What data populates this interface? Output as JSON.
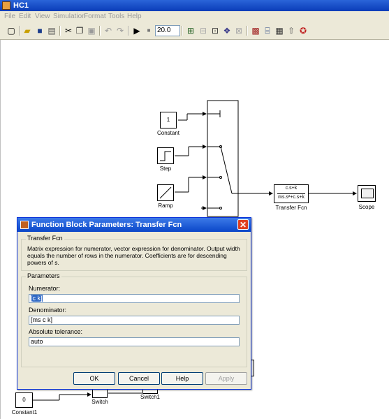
{
  "window": {
    "title": "HC1"
  },
  "menu": [
    "File",
    "Edit",
    "View",
    "Simulation",
    "Format",
    "Tools",
    "Help"
  ],
  "toolbar": {
    "sim_time": "20.0",
    "icons": [
      "new-icon",
      "open-icon",
      "save-icon",
      "print-icon",
      "cut-icon",
      "copy-icon",
      "paste-icon",
      "undo-icon",
      "redo-icon",
      "play-icon",
      "stop-icon",
      "build-icon",
      "update-icon",
      "library-icon",
      "explorer-icon",
      "debug-icon",
      "model-advisor-icon",
      "up-icon",
      "help-icon"
    ]
  },
  "diagram": {
    "blocks": {
      "constant": {
        "value": "1",
        "label": "Constant"
      },
      "step": {
        "label": "Step"
      },
      "ramp": {
        "label": "Ramp"
      },
      "transfer_fcn": {
        "num": "c.s+k",
        "den": "ms.s²+c.s+k",
        "label": "Transfer Fcn"
      },
      "scope": {
        "label": "Scope"
      },
      "constant1": {
        "value": "0",
        "label": "Constant1"
      },
      "switch": {
        "label": "Switch"
      },
      "switch1": {
        "label": "Switch1"
      }
    }
  },
  "dialog": {
    "title": "Function Block Parameters: Transfer Fcn",
    "section1_legend": "Transfer Fcn",
    "description": "Matrix expression for numerator, vector expression for denominator.  Output width equals the number of rows in the numerator.  Coefficients are for descending powers of s.",
    "section2_legend": "Parameters",
    "numerator_label": "Numerator:",
    "numerator_value": "[c k]",
    "denominator_label": "Denominator:",
    "denominator_value": "[ms c k]",
    "abstol_label": "Absolute tolerance:",
    "abstol_value": "auto",
    "buttons": {
      "ok": "OK",
      "cancel": "Cancel",
      "help": "Help",
      "apply": "Apply"
    }
  }
}
